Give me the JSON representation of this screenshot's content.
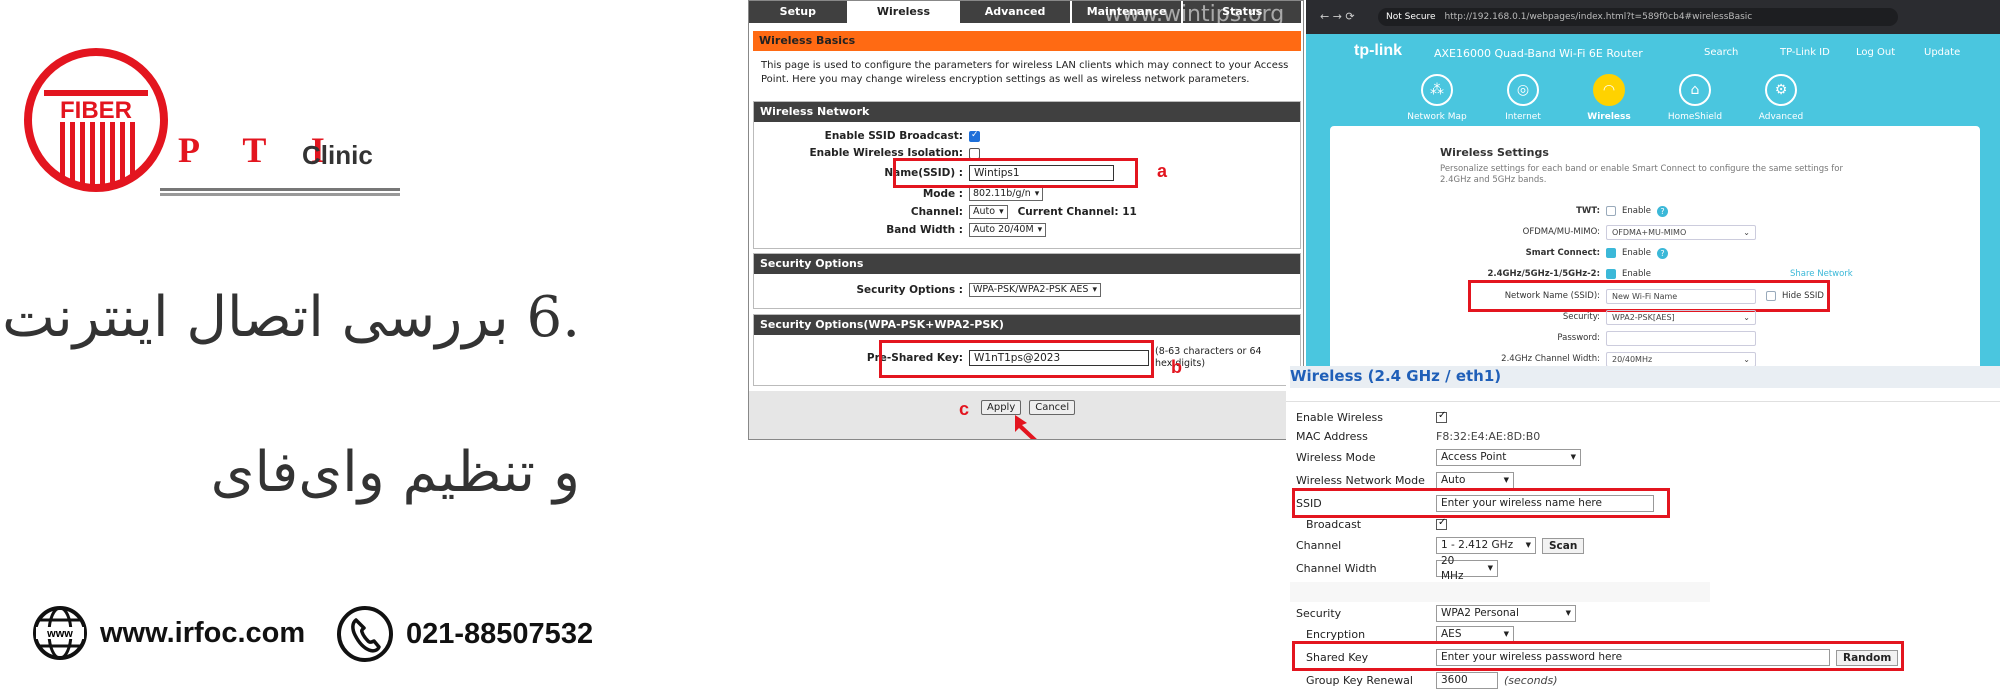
{
  "promo": {
    "logo_word1": "FIBER",
    "logo_word2_letters": "P T I",
    "logo_word3": "Clinic",
    "title_line1": ".6 بررسی اتصال اینترنت",
    "title_line2": "و تنظیم وای‌فای",
    "website": "www.irfoc.com",
    "phone": "021-88507532"
  },
  "panel_a": {
    "tabs": [
      "Setup",
      "Wireless",
      "Advanced",
      "Maintenance",
      "Status"
    ],
    "active_tab": "Wireless",
    "watermark": "www.wintips.org",
    "basics_title": "Wireless Basics",
    "basics_desc": "This page is used to configure the parameters for wireless LAN clients which may connect to your Access Point. Here you may change wireless encryption settings as well as wireless network parameters.",
    "network_title": "Wireless Network",
    "lbl_ssid_broadcast": "Enable SSID Broadcast:",
    "lbl_isolation": "Enable Wireless Isolation:",
    "lbl_name": "Name(SSID) :",
    "ssid_value": "Wintips1",
    "lbl_mode": "Mode :",
    "mode_value": "802.11b/g/n",
    "lbl_channel": "Channel:",
    "channel_value": "Auto",
    "current_channel": "Current Channel: 11",
    "lbl_bandwidth": "Band Width :",
    "bandwidth_value": "Auto 20/40M",
    "security_title": "Security Options",
    "lbl_security": "Security Options :",
    "security_value": "WPA-PSK/WPA2-PSK AES",
    "wpa_title": "Security Options(WPA-PSK+WPA2-PSK)",
    "lbl_psk": "Pre-Shared Key:",
    "psk_value": "W1nT1ps@2023",
    "psk_hint": "(8-63 characters or 64 hex digits)",
    "apply": "Apply",
    "cancel": "Cancel",
    "marker_a": "a",
    "marker_b": "b",
    "marker_c": "c",
    "accent_orange": "#ff6a13",
    "highlight_red": "#e3151f"
  },
  "panel_b": {
    "not_secure": "Not Secure",
    "url": "http://192.168.0.1/webpages/index.html?t=589f0cb4#wirelessBasic",
    "brand": "tp-link",
    "model": "AXE16000 Quad-Band Wi-Fi 6E Router",
    "top_links": [
      "Search",
      "TP-Link ID",
      "Log Out",
      "Update"
    ],
    "nav": [
      "Network Map",
      "Internet",
      "Wireless",
      "HomeShield",
      "Advanced"
    ],
    "active_nav": "Wireless",
    "card_title": "Wireless Settings",
    "card_desc": "Personalize settings for each band or enable Smart Connect to configure the same settings for 2.4GHz and 5GHz bands.",
    "lbl_twt": "TWT:",
    "twt_value": "Enable",
    "lbl_ofdma": "OFDMA/MU-MIMO:",
    "ofdma_value": "OFDMA+MU-MIMO",
    "lbl_smart": "Smart Connect:",
    "smart_value": "Enable",
    "lbl_band": "2.4GHz/5GHz-1/5GHz-2:",
    "band_value": "Enable",
    "share_network": "Share Network",
    "lbl_ssid": "Network Name (SSID):",
    "ssid_value": "New Wi-Fi Name",
    "hide_ssid": "Hide SSID",
    "lbl_security": "Security:",
    "security_value": "WPA2-PSK[AES]",
    "lbl_password": "Password:",
    "password_value": "",
    "lbl_width": "2.4GHz Channel Width:",
    "width_value": "20/40MHz",
    "accent_cyan": "#4ac6df"
  },
  "panel_c": {
    "title": "Wireless (2.4 GHz / eth1)",
    "lbl_enable": "Enable Wireless",
    "lbl_mac": "MAC Address",
    "mac_value": "F8:32:E4:AE:8D:B0",
    "lbl_mode": "Wireless Mode",
    "mode_value": "Access Point",
    "lbl_netmode": "Wireless Network Mode",
    "netmode_value": "Auto",
    "lbl_ssid": "SSID",
    "ssid_placeholder": "Enter your wireless name here",
    "lbl_broadcast": "Broadcast",
    "lbl_channel": "Channel",
    "channel_value": "1 - 2.412 GHz",
    "scan": "Scan",
    "lbl_width": "Channel Width",
    "width_value": "20 MHz",
    "lbl_security": "Security",
    "security_value": "WPA2 Personal",
    "lbl_encryption": "Encryption",
    "encryption_value": "AES",
    "lbl_key": "Shared Key",
    "key_placeholder": "Enter your wireless password here",
    "random": "Random",
    "lbl_renewal": "Group Key Renewal",
    "renewal_value": "3600",
    "renewal_unit": "(seconds)",
    "title_blue": "#1f5fb8"
  }
}
